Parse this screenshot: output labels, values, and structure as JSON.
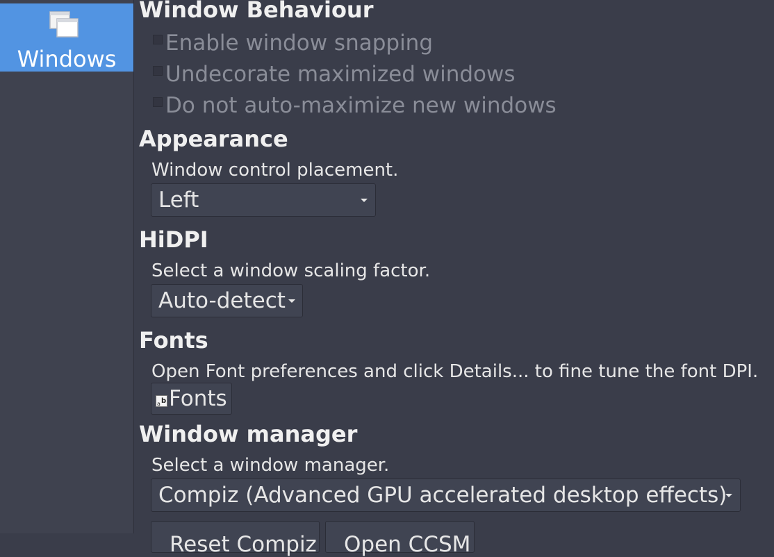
{
  "sidebar": {
    "items": [
      {
        "label": "Windows",
        "icon": "windows-icon",
        "selected": true
      }
    ]
  },
  "sections": {
    "window_behaviour": {
      "title": "Window Behaviour",
      "options": [
        {
          "label": "Enable window snapping",
          "checked": false,
          "enabled": false
        },
        {
          "label": "Undecorate maximized windows",
          "checked": false,
          "enabled": false
        },
        {
          "label": "Do not auto-maximize new windows",
          "checked": false,
          "enabled": false
        }
      ]
    },
    "appearance": {
      "title": "Appearance",
      "description": "Window control placement.",
      "dropdown_value": "Left"
    },
    "hidpi": {
      "title": "HiDPI",
      "description": "Select a window scaling factor.",
      "dropdown_value": "Auto-detect"
    },
    "fonts": {
      "title": "Fonts",
      "description": "Open Font preferences and click Details... to fine tune the font DPI.",
      "button_label": "Fonts",
      "button_icon": "fonts-icon"
    },
    "window_manager": {
      "title": "Window manager",
      "description": "Select a window manager.",
      "dropdown_value": "Compiz (Advanced GPU accelerated desktop effects)",
      "buttons": [
        "Reset Compiz",
        "Open CCSM"
      ]
    }
  },
  "colors": {
    "background": "#3a3d4a",
    "sidebar": "#3f424f",
    "accent": "#5294e2",
    "text": "#e6e6e6",
    "disabled_text": "#8a8d98"
  }
}
